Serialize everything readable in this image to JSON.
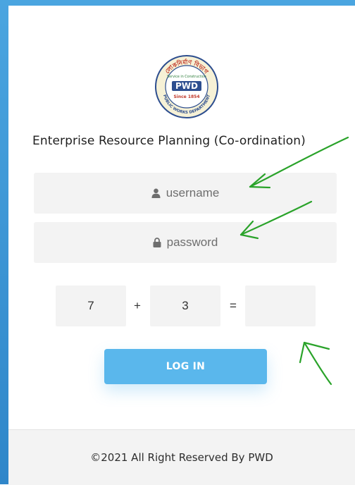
{
  "header": {
    "title": "Enterprise Resource Planning (Co-ordination)"
  },
  "logo": {
    "top_text": "লোকনির্মাণ বিভাগ",
    "motto": "Service in Construction",
    "monogram": "PWD",
    "since": "Since 1854",
    "bottom_text": "PUBLIC WORKS DEPARTMENT"
  },
  "login_form": {
    "username_placeholder": "username",
    "password_placeholder": "password",
    "captcha": {
      "operand_a": "7",
      "operator": "+",
      "operand_b": "3",
      "equals": "=",
      "answer_value": ""
    },
    "login_label": "LOG IN"
  },
  "footer": {
    "text": "©2021 All Right Reserved By PWD"
  },
  "colors": {
    "accent": "#5ab7ec",
    "frame_blue": "#4aa5e0",
    "field_bg": "#f3f3f3",
    "annotation_green": "#2aa32a"
  },
  "icons": {
    "username": "user-icon",
    "password": "lock-icon"
  }
}
